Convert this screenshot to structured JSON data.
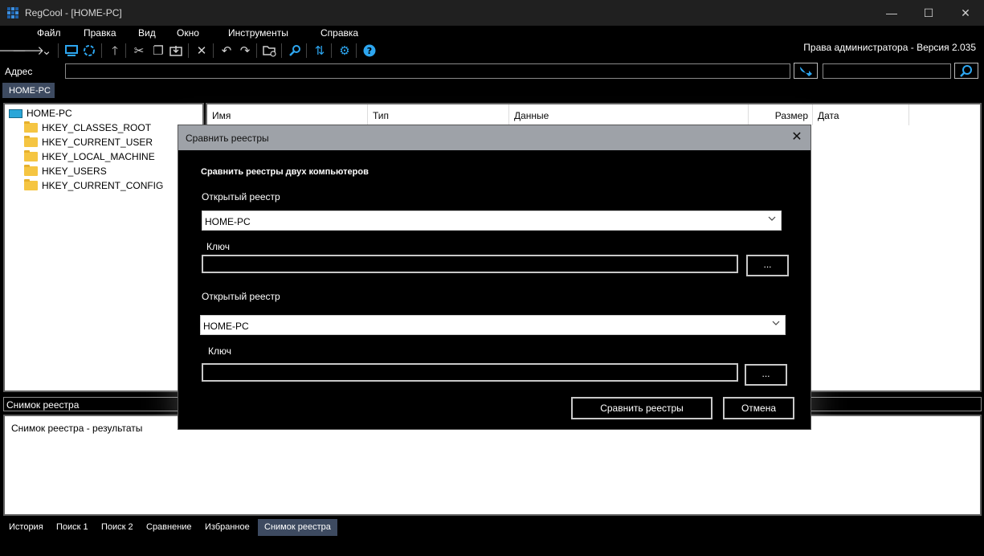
{
  "window": {
    "title": "RegCool - [HOME-PC]",
    "minimize": "—",
    "maximize": "☐",
    "close": "✕"
  },
  "menu": {
    "file": "Файл",
    "edit": "Правка",
    "view": "Вид",
    "window": "Окно",
    "tools": "Инструменты",
    "help": "Справка"
  },
  "toolbar": {
    "rights_text": "Права администратора - Версия 2.035"
  },
  "address": {
    "label": "Адрес",
    "value": "",
    "search_value": ""
  },
  "tabs": {
    "home": "HOME-PC"
  },
  "tree": {
    "root": "HOME-PC",
    "items": [
      "HKEY_CLASSES_ROOT",
      "HKEY_CURRENT_USER",
      "HKEY_LOCAL_MACHINE",
      "HKEY_USERS",
      "HKEY_CURRENT_CONFIG"
    ]
  },
  "list": {
    "columns": [
      "Имя",
      "Тип",
      "Данные",
      "Размер",
      "Дата"
    ]
  },
  "snapshot": {
    "label": "Снимок реестра",
    "results_text": "Снимок реестра - результаты"
  },
  "bottom_tabs": [
    "История",
    "Поиск 1",
    "Поиск 2",
    "Сравнение",
    "Избранное",
    "Снимок реестра"
  ],
  "dialog": {
    "title": "Сравнить реестры",
    "heading": "Сравнить реестры двух компьютеров",
    "reg1_label": "Открытый реестр",
    "reg1_value": "HOME-PC",
    "key1_label": "Ключ",
    "key1_value": "",
    "browse1": "...",
    "reg2_label": "Открытый реестр",
    "reg2_value": "HOME-PC",
    "key2_label": "Ключ",
    "key2_value": "",
    "browse2": "...",
    "compare_button": "Сравнить реестры",
    "cancel_button": "Отмена"
  },
  "colors": {
    "accent": "#2da6f0",
    "tab_active": "#3d4a60",
    "dialog_title_bg": "#9ea2a8"
  }
}
